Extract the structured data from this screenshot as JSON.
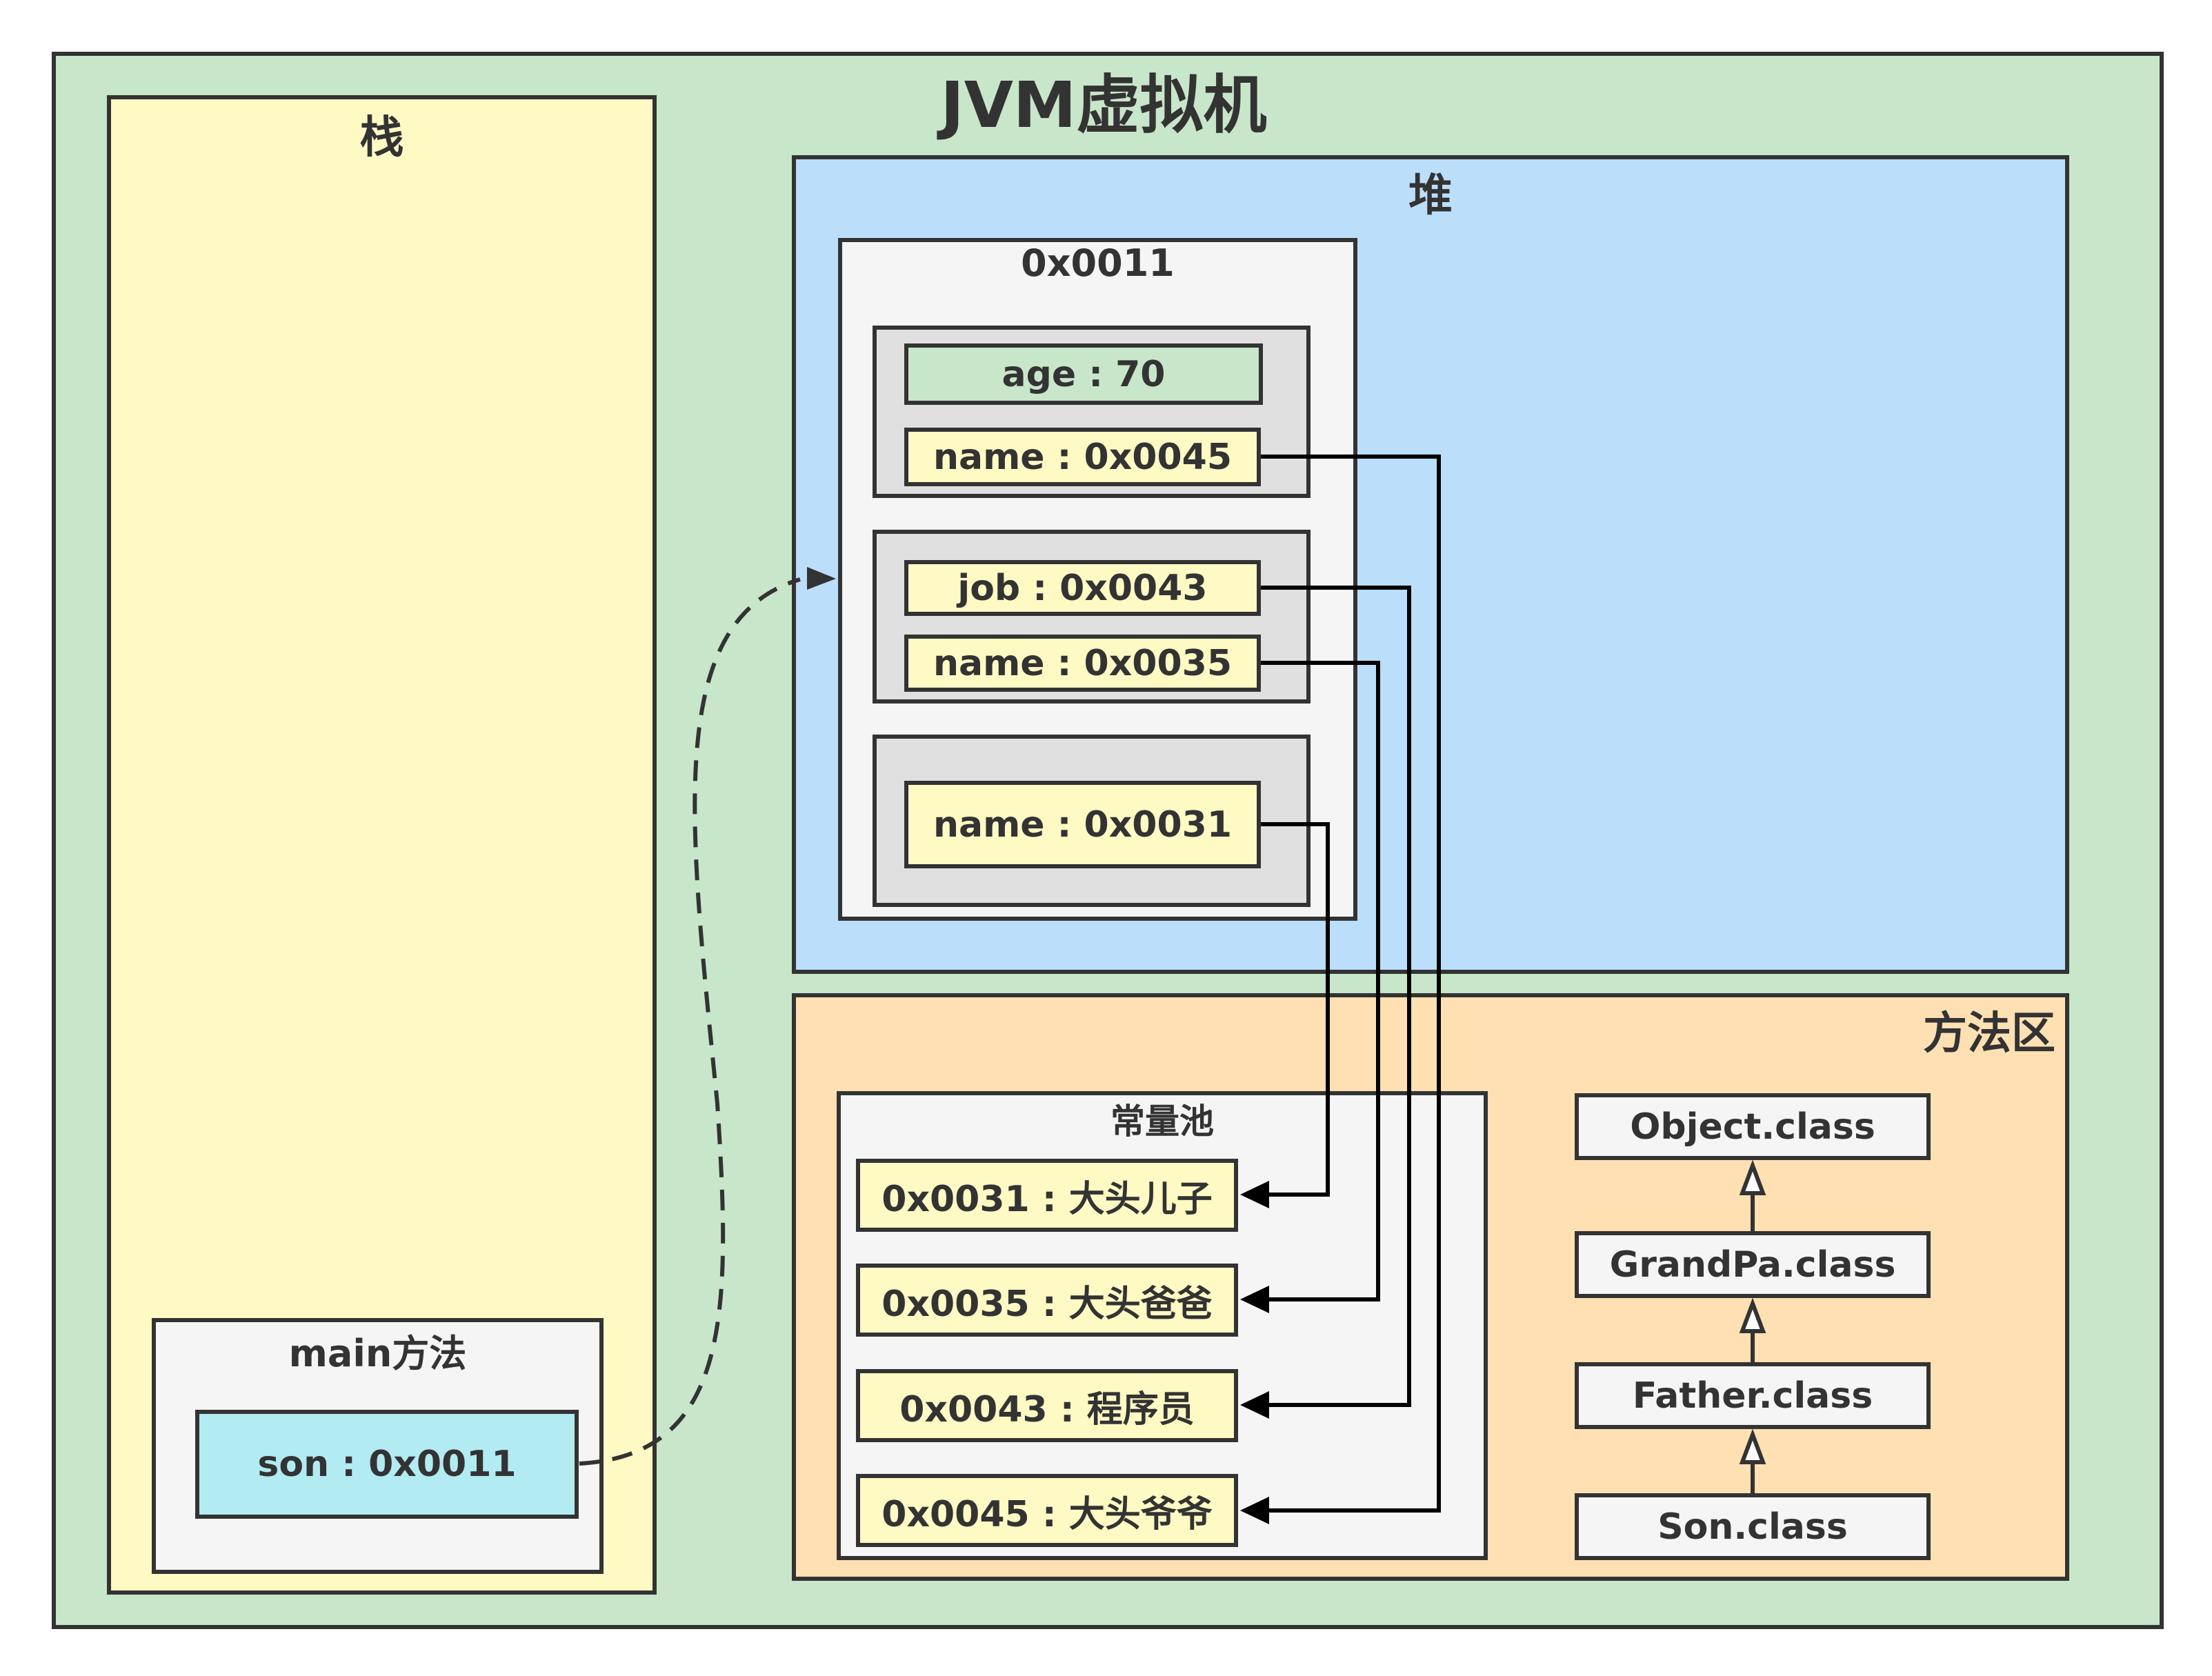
{
  "title": "JVM虚拟机",
  "stack": {
    "title": "栈",
    "frame": {
      "title": "main方法",
      "variable": "son : 0x0011"
    }
  },
  "heap": {
    "title": "堆",
    "object": {
      "address": "0x0011",
      "parts": [
        {
          "fields": [
            "age : 70",
            "name : 0x0045"
          ]
        },
        {
          "fields": [
            "job : 0x0043",
            "name : 0x0035"
          ]
        },
        {
          "fields": [
            "name : 0x0031"
          ]
        }
      ]
    }
  },
  "method_area": {
    "title": "方法区",
    "constant_pool": {
      "title": "常量池",
      "entries": [
        "0x0031 : 大头儿子",
        "0x0035 : 大头爸爸",
        "0x0043 : 程序员",
        "0x0045 : 大头爷爷"
      ]
    },
    "classes": [
      "Object.class",
      "GrandPa.class",
      "Father.class",
      "Son.class"
    ]
  },
  "references": [
    {
      "from": "son : 0x0011",
      "to": "0x0011",
      "style": "dashed-curve"
    },
    {
      "from": "name : 0x0045",
      "to": "0x0045 : 大头爷爷"
    },
    {
      "from": "job : 0x0043",
      "to": "0x0043 : 程序员"
    },
    {
      "from": "name : 0x0035",
      "to": "0x0035 : 大头爸爸"
    },
    {
      "from": "name : 0x0031",
      "to": "0x0031 : 大头儿子"
    },
    {
      "from": "Son.class",
      "to": "Father.class",
      "style": "inheritance"
    },
    {
      "from": "Father.class",
      "to": "GrandPa.class",
      "style": "inheritance"
    },
    {
      "from": "GrandPa.class",
      "to": "Object.class",
      "style": "inheritance"
    }
  ],
  "colors": {
    "jvm_bg": "#c8e6c9",
    "stack_bg": "#fff9c4",
    "heap_bg": "#bbdefb",
    "method_area_bg": "#ffe0b2",
    "stroke": "#333333",
    "reference_var_bg": "#b2ebf2"
  }
}
